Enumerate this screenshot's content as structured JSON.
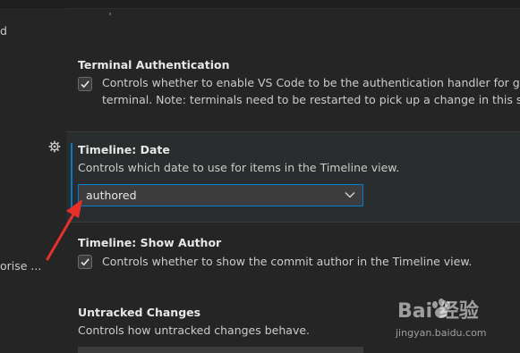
{
  "left_pane": {
    "top_fragment": "d",
    "bottom_fragment": "orise ..."
  },
  "settings": {
    "terminal_auth": {
      "title": "Terminal Authentication",
      "desc_line1": "Controls whether to enable VS Code to be the authentication handler for git proce",
      "desc_line2": "terminal. Note: terminals need to be restarted to pick up a change in this setting.",
      "checked": true
    },
    "timeline_date": {
      "category": "Timeline: ",
      "name": "Date",
      "desc": "Controls which date to use for items in the Timeline view.",
      "selected": "authored"
    },
    "timeline_show_author": {
      "category": "Timeline: ",
      "name": "Show Author",
      "desc": "Controls whether to show the commit author in the Timeline view.",
      "checked": true
    },
    "untracked_changes": {
      "title": "Untracked Changes",
      "desc": "Controls how untracked changes behave."
    }
  },
  "watermark": {
    "brand": "Bai 经验",
    "url": "jingyan.baidu.com"
  },
  "colors": {
    "background": "#252526",
    "focus_accent": "#007acc",
    "annotation_arrow": "#e8302a"
  }
}
